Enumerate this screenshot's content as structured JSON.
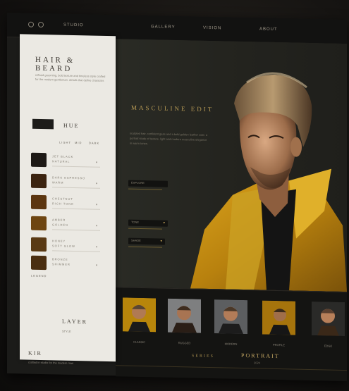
{
  "topbar": {
    "nav1": "STUDIO",
    "nav2": "GALLERY",
    "nav3": "VISION",
    "nav4": "ABOUT"
  },
  "panel": {
    "title": "HAIR & BEARD",
    "description": "refined grooming, bold texture and timeless style crafted for the modern gentleman. details that define character.",
    "subheading": "HUE",
    "tabs": [
      "LIGHT",
      "MID",
      "DARK"
    ],
    "swatches": [
      {
        "label": "JET BLACK",
        "sub": "NATURAL",
        "color": "#1e1a16"
      },
      {
        "label": "DARK ESPRESSO",
        "sub": "WARM",
        "color": "#3c2410"
      },
      {
        "label": "CHESTNUT",
        "sub": "RICH TONE",
        "color": "#5c3610"
      },
      {
        "label": "AMBER",
        "sub": "GOLDEN",
        "color": "#6e4612"
      },
      {
        "label": "HONEY",
        "sub": "SOFT GLOW",
        "color": "#5a3a14"
      },
      {
        "label": "BRONZE",
        "sub": "SHIMMER",
        "color": "#4a2e10"
      }
    ],
    "section_label": "LEGEND",
    "footer_title": "LAYER",
    "footer_sub": "STYLE",
    "footer_brand": "KIR",
    "footer_copy": "crafted in studio for the modern man"
  },
  "main": {
    "heading": "MASCULINE EDIT",
    "paragraph": "sculpted hair, confident gaze and a bold golden leather coat. a portrait study of texture, light and modern masculine elegance in warm tones.",
    "pills": [
      "EXPLORE",
      "TONE",
      "SHADE"
    ]
  },
  "thumbnails": {
    "captions": [
      "CLASSIC",
      "RUGGED",
      "MODERN",
      "PROFILE",
      "EDGE"
    ],
    "bottom_left": "SERIES",
    "bottom_center": "PORTRAIT",
    "bottom_sub": "2024"
  },
  "colors": {
    "accent": "#b79a55",
    "panel_bg": "#ebe9e3",
    "main_bg": "#24241f"
  }
}
